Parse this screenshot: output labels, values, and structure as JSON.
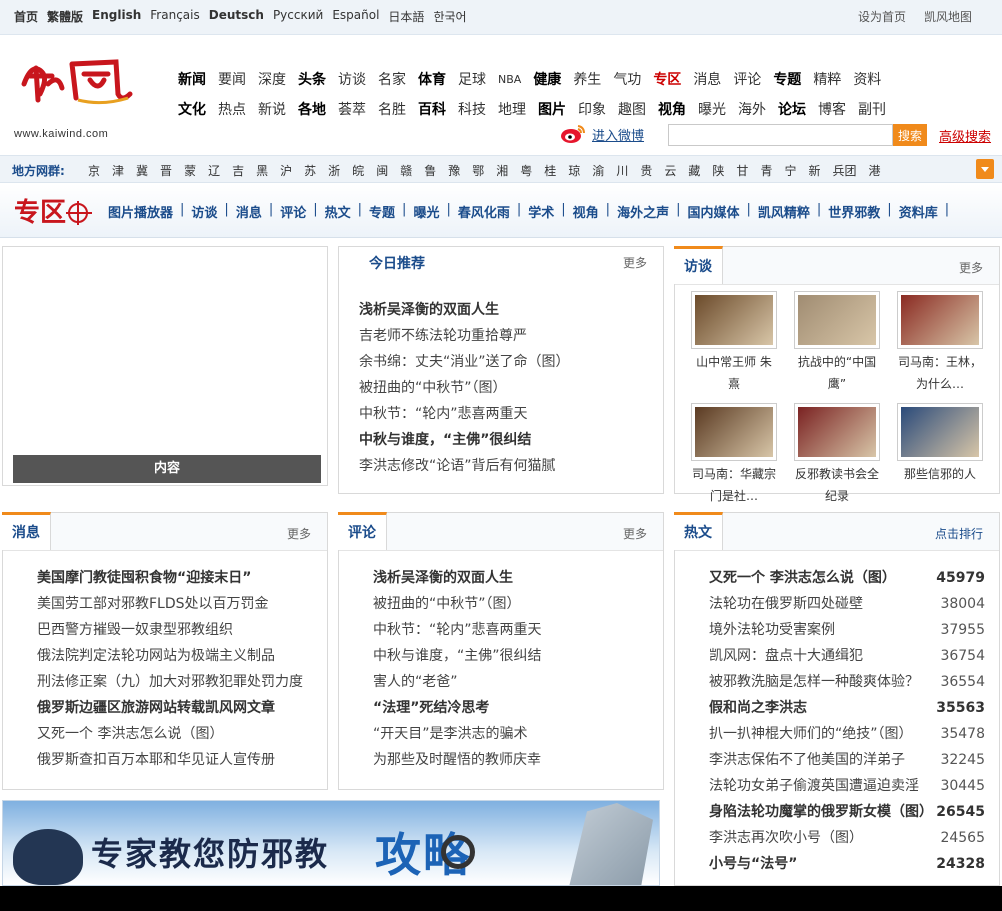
{
  "langbar": {
    "items": [
      {
        "label": "首页",
        "bold": true
      },
      {
        "label": "繁體版",
        "bold": true
      },
      {
        "label": "English",
        "bold": true
      },
      {
        "label": "Français",
        "bold": false
      },
      {
        "label": "Deutsch",
        "bold": true
      },
      {
        "label": "Русский",
        "bold": false
      },
      {
        "label": "Español",
        "bold": false
      },
      {
        "label": "日本語",
        "bold": false
      },
      {
        "label": "한국어",
        "bold": false
      }
    ],
    "set_home": "设为首页",
    "sitemap": "凯风地图"
  },
  "logo": {
    "url_text": "www.kaiwind.com"
  },
  "nav": {
    "row1": [
      {
        "label": "新闻",
        "style": "b"
      },
      {
        "label": "要闻",
        "style": ""
      },
      {
        "label": "深度",
        "style": ""
      },
      {
        "label": "头条",
        "style": "b"
      },
      {
        "label": "访谈",
        "style": ""
      },
      {
        "label": "名家",
        "style": ""
      },
      {
        "label": "体育",
        "style": "b"
      },
      {
        "label": "足球",
        "style": ""
      },
      {
        "label": "NBA",
        "style": "sm"
      },
      {
        "label": "健康",
        "style": "b"
      },
      {
        "label": "养生",
        "style": ""
      },
      {
        "label": "气功",
        "style": ""
      },
      {
        "label": "专区",
        "style": "red"
      },
      {
        "label": "消息",
        "style": ""
      },
      {
        "label": "评论",
        "style": ""
      },
      {
        "label": "专题",
        "style": "b"
      },
      {
        "label": "精粹",
        "style": ""
      },
      {
        "label": "资料",
        "style": ""
      }
    ],
    "row2": [
      {
        "label": "文化",
        "style": "b"
      },
      {
        "label": "热点",
        "style": ""
      },
      {
        "label": "新说",
        "style": ""
      },
      {
        "label": "各地",
        "style": "b"
      },
      {
        "label": "荟萃",
        "style": ""
      },
      {
        "label": "名胜",
        "style": ""
      },
      {
        "label": "百科",
        "style": "b"
      },
      {
        "label": "科技",
        "style": ""
      },
      {
        "label": "地理",
        "style": ""
      },
      {
        "label": "图片",
        "style": "b"
      },
      {
        "label": "印象",
        "style": ""
      },
      {
        "label": "趣图",
        "style": ""
      },
      {
        "label": "视角",
        "style": "b"
      },
      {
        "label": "曝光",
        "style": ""
      },
      {
        "label": "海外",
        "style": ""
      },
      {
        "label": "论坛",
        "style": "b"
      },
      {
        "label": "博客",
        "style": ""
      },
      {
        "label": "副刊",
        "style": ""
      }
    ]
  },
  "weibo": {
    "label": "进入微博"
  },
  "search": {
    "placeholder": "",
    "button": "搜索",
    "advanced": "高级搜索"
  },
  "local": {
    "label": "地方网群:",
    "items": [
      "京",
      "津",
      "冀",
      "晋",
      "蒙",
      "辽",
      "吉",
      "黑",
      "沪",
      "苏",
      "浙",
      "皖",
      "闽",
      "赣",
      "鲁",
      "豫",
      "鄂",
      "湘",
      "粤",
      "桂",
      "琼",
      "渝",
      "川",
      "贵",
      "云",
      "藏",
      "陕",
      "甘",
      "青",
      "宁",
      "新",
      "兵团",
      "港"
    ]
  },
  "zone": {
    "items": [
      "图片播放器",
      "访谈",
      "消息",
      "评论",
      "热文",
      "专题",
      "曝光",
      "春风化雨",
      "学术",
      "视角",
      "海外之声",
      "国内媒体",
      "凯风精粹",
      "世界邪教",
      "资料库"
    ]
  },
  "slideshow": {
    "caption": "内容"
  },
  "today": {
    "title": "今日推荐",
    "more": "更多",
    "items": [
      {
        "text": "浅析吴泽衡的双面人生",
        "bold": true
      },
      {
        "text": "吉老师不练法轮功重拾尊严",
        "bold": false
      },
      {
        "text": "余书绵：丈夫“消业”送了命（图）",
        "bold": false
      },
      {
        "text": "被扭曲的“中秋节”（图）",
        "bold": false
      },
      {
        "text": "中秋节：“轮内”悲喜两重天",
        "bold": false
      },
      {
        "text": "中秋与谁度，“主佛”很纠结",
        "bold": true
      },
      {
        "text": "李洪志修改“论语”背后有何猫腻",
        "bold": false
      }
    ]
  },
  "interviews": {
    "title": "访谈",
    "more": "更多",
    "items": [
      {
        "caption": "山中常王师 朱熹",
        "color": "#6b4a2a"
      },
      {
        "caption": "抗战中的“中国鹰”",
        "color": "#a08c72"
      },
      {
        "caption": "司马南：王林，为什么…",
        "color": "#8a2a22"
      },
      {
        "caption": "司马南：华藏宗门是社…",
        "color": "#5a3a22"
      },
      {
        "caption": "反邪教读书会全纪录",
        "color": "#7a2222"
      },
      {
        "caption": "那些信邪的人",
        "color": "#2a4a7a"
      }
    ]
  },
  "news": {
    "title": "消息",
    "more": "更多",
    "items": [
      {
        "text": "美国摩门教徒囤积食物“迎接末日”",
        "bold": true
      },
      {
        "text": "美国劳工部对邪教FLDS处以百万罚金",
        "bold": false
      },
      {
        "text": "巴西警方摧毁一奴隶型邪教组织",
        "bold": false
      },
      {
        "text": "俄法院判定法轮功网站为极端主义制品",
        "bold": false
      },
      {
        "text": "刑法修正案（九）加大对邪教犯罪处罚力度",
        "bold": false
      },
      {
        "text": "俄罗斯边疆区旅游网站转载凯风网文章",
        "bold": true
      },
      {
        "text": "又死一个 李洪志怎么说（图）",
        "bold": false
      },
      {
        "text": "俄罗斯查扣百万本耶和华见证人宣传册",
        "bold": false
      }
    ]
  },
  "comments": {
    "title": "评论",
    "more": "更多",
    "items": [
      {
        "text": "浅析吴泽衡的双面人生",
        "bold": true
      },
      {
        "text": "被扭曲的“中秋节”（图）",
        "bold": false
      },
      {
        "text": "中秋节：“轮内”悲喜两重天",
        "bold": false
      },
      {
        "text": "中秋与谁度，“主佛”很纠结",
        "bold": false
      },
      {
        "text": "害人的“老爸”",
        "bold": false
      },
      {
        "text": "“法理”死结冷思考",
        "bold": true
      },
      {
        "text": "“开天目”是李洪志的骗术",
        "bold": false
      },
      {
        "text": "为那些及时醒悟的教师庆幸",
        "bold": false
      }
    ]
  },
  "hot": {
    "title": "热文",
    "rank": "点击排行",
    "items": [
      {
        "text": "又死一个 李洪志怎么说（图）",
        "num": "45979",
        "bold": true
      },
      {
        "text": "法轮功在俄罗斯四处碰壁",
        "num": "38004",
        "bold": false
      },
      {
        "text": "境外法轮功受害案例",
        "num": "37955",
        "bold": false
      },
      {
        "text": "凯风网：盘点十大通缉犯",
        "num": "36754",
        "bold": false
      },
      {
        "text": "被邪教洗脑是怎样一种酸爽体验？",
        "num": "36554",
        "bold": false
      },
      {
        "text": "假和尚之李洪志",
        "num": "35563",
        "bold": true
      },
      {
        "text": "扒一扒神棍大师们的“绝技”（图）",
        "num": "35478",
        "bold": false
      },
      {
        "text": "李洪志保佑不了他美国的洋弟子",
        "num": "32245",
        "bold": false
      },
      {
        "text": "法轮功女弟子偷渡英国遭逼迫卖淫",
        "num": "30445",
        "bold": false
      },
      {
        "text": "身陷法轮功魔掌的俄罗斯女模（图）",
        "num": "26545",
        "bold": true
      },
      {
        "text": "李洪志再次吹小号（图）",
        "num": "24565",
        "bold": false
      },
      {
        "text": "小号与“法号”",
        "num": "24328",
        "bold": true
      }
    ]
  },
  "banner": {
    "text": "专家教您防邪教",
    "big": "攻略"
  }
}
